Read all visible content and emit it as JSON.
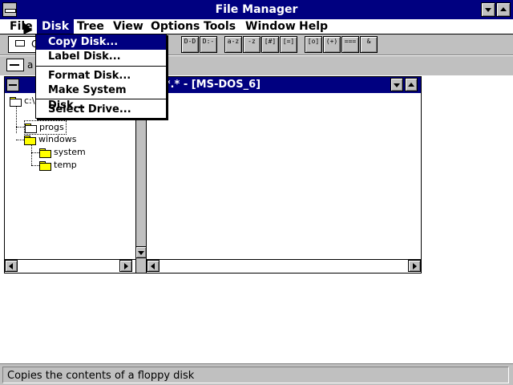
{
  "app": {
    "title": "File Manager"
  },
  "menubar": {
    "items": [
      {
        "label": "File"
      },
      {
        "label": "Disk"
      },
      {
        "label": "Tree"
      },
      {
        "label": "View"
      },
      {
        "label": "Options"
      },
      {
        "label": "Tools"
      },
      {
        "label": "Window"
      },
      {
        "label": "Help"
      }
    ]
  },
  "disk_menu": {
    "items": [
      {
        "label": "Copy Disk...",
        "highlighted": true
      },
      {
        "label": "Label Disk..."
      },
      {
        "label": "Format Disk..."
      },
      {
        "label": "Make System Disk..."
      },
      {
        "label": "Select Drive..."
      }
    ]
  },
  "toolbar": {
    "combo_value": "C",
    "buttons": [
      {
        "icon": "connect-drive-icon",
        "glyph": "D-D"
      },
      {
        "icon": "disconnect-drive-icon",
        "glyph": "D:-"
      },
      {
        "icon": "sort-name-icon",
        "glyph": "a-z"
      },
      {
        "icon": "sort-type-icon",
        "glyph": "-z"
      },
      {
        "icon": "sort-size-icon",
        "glyph": "[#]"
      },
      {
        "icon": "sort-date-icon",
        "glyph": "[=]"
      },
      {
        "icon": "share-icon",
        "glyph": "[o]"
      },
      {
        "icon": "stop-sharing-icon",
        "glyph": "(+)"
      },
      {
        "icon": "view-list-icon",
        "glyph": "==="
      },
      {
        "icon": "run-icon",
        "glyph": "&"
      }
    ],
    "button_colors": {
      "face": "#c0c0c0",
      "border": "#000000"
    }
  },
  "drivebar": {
    "drive_label": "a"
  },
  "child_window": {
    "caption": "OGS\\*.* - [MS-DOS_6]",
    "tree": [
      {
        "label": "c:\\",
        "depth": 0,
        "icon": "folder-icon"
      },
      {
        "label": "progs",
        "depth": 1,
        "icon": "open-folder-icon",
        "selected": true
      },
      {
        "label": "windows",
        "depth": 1,
        "icon": "folder-icon"
      },
      {
        "label": "system",
        "depth": 2,
        "icon": "folder-icon"
      },
      {
        "label": "temp",
        "depth": 2,
        "icon": "folder-icon"
      }
    ]
  },
  "statusbar": {
    "text": "Copies the contents of a floppy disk"
  },
  "colors": {
    "title_bar": "#000080",
    "menu_highlight": "#000080",
    "chrome": "#c0c0c0",
    "folder": "#ffff00"
  }
}
